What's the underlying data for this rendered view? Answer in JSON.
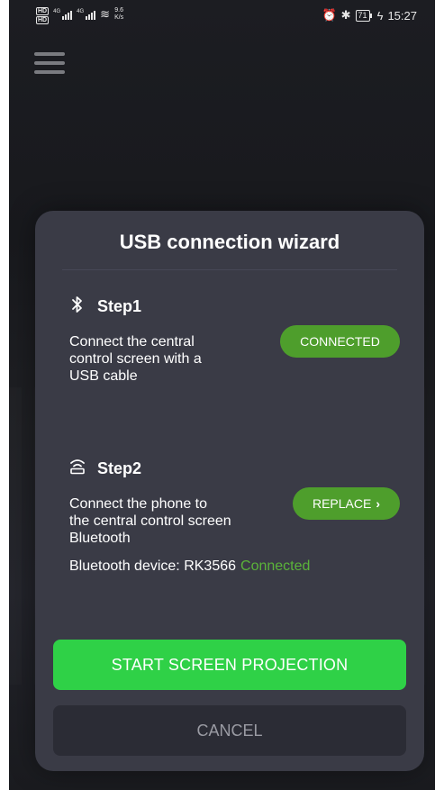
{
  "status_bar": {
    "hd_top": "HD",
    "hd_bottom": "HD",
    "net1": "4G",
    "net2": "4G",
    "speed_value": "9.6",
    "speed_unit": "K/s",
    "battery": "71",
    "time": "15:27"
  },
  "dialog": {
    "title": "USB connection wizard",
    "step1": {
      "icon": "bluetooth-icon",
      "title": "Step1",
      "line1": "Connect the central",
      "line2": "control screen with a",
      "line3": "USB cable",
      "button": "CONNECTED"
    },
    "step2": {
      "icon": "wifi-icon",
      "title": "Step2",
      "line1": "Connect the phone to",
      "line2": "the central control screen",
      "line3": "Bluetooth",
      "button": "REPLACE",
      "device_label": "Bluetooth device: RK3566",
      "device_status": "Connected"
    },
    "start_button": "START SCREEN PROJECTION",
    "cancel_button": "CANCEL"
  },
  "colors": {
    "accent_green": "#2fd147",
    "pill_green": "#4e9e2c",
    "status_green": "#5bb33a",
    "dialog_bg": "#3a3b46"
  }
}
